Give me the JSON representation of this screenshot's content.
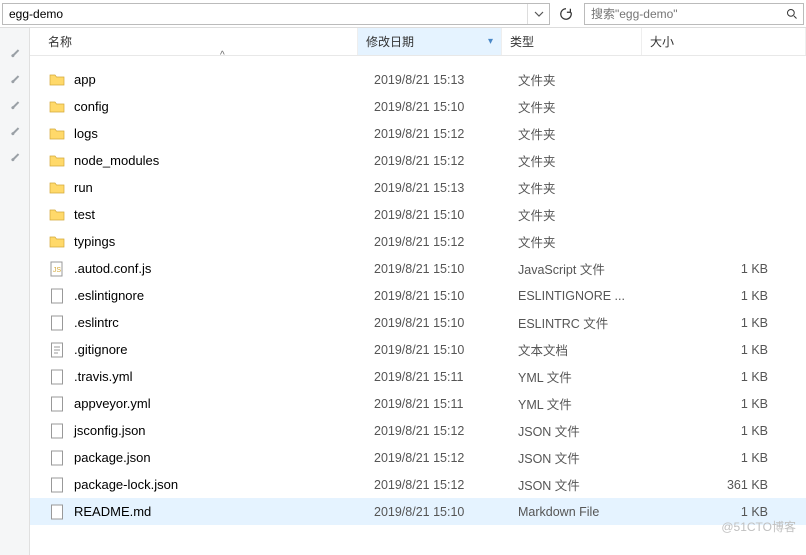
{
  "path": {
    "current": "egg-demo"
  },
  "search": {
    "placeholder": "搜索\"egg-demo\""
  },
  "columns": {
    "name": "名称",
    "date": "修改日期",
    "type": "类型",
    "size": "大小"
  },
  "items": [
    {
      "name": "app",
      "date": "2019/8/21 15:13",
      "type": "文件夹",
      "size": "",
      "kind": "folder"
    },
    {
      "name": "config",
      "date": "2019/8/21 15:10",
      "type": "文件夹",
      "size": "",
      "kind": "folder"
    },
    {
      "name": "logs",
      "date": "2019/8/21 15:12",
      "type": "文件夹",
      "size": "",
      "kind": "folder"
    },
    {
      "name": "node_modules",
      "date": "2019/8/21 15:12",
      "type": "文件夹",
      "size": "",
      "kind": "folder"
    },
    {
      "name": "run",
      "date": "2019/8/21 15:13",
      "type": "文件夹",
      "size": "",
      "kind": "folder"
    },
    {
      "name": "test",
      "date": "2019/8/21 15:10",
      "type": "文件夹",
      "size": "",
      "kind": "folder"
    },
    {
      "name": "typings",
      "date": "2019/8/21 15:12",
      "type": "文件夹",
      "size": "",
      "kind": "folder"
    },
    {
      "name": ".autod.conf.js",
      "date": "2019/8/21 15:10",
      "type": "JavaScript 文件",
      "size": "1 KB",
      "kind": "js"
    },
    {
      "name": ".eslintignore",
      "date": "2019/8/21 15:10",
      "type": "ESLINTIGNORE ...",
      "size": "1 KB",
      "kind": "file"
    },
    {
      "name": ".eslintrc",
      "date": "2019/8/21 15:10",
      "type": "ESLINTRC 文件",
      "size": "1 KB",
      "kind": "file"
    },
    {
      "name": ".gitignore",
      "date": "2019/8/21 15:10",
      "type": "文本文档",
      "size": "1 KB",
      "kind": "text"
    },
    {
      "name": ".travis.yml",
      "date": "2019/8/21 15:11",
      "type": "YML 文件",
      "size": "1 KB",
      "kind": "file"
    },
    {
      "name": "appveyor.yml",
      "date": "2019/8/21 15:11",
      "type": "YML 文件",
      "size": "1 KB",
      "kind": "file"
    },
    {
      "name": "jsconfig.json",
      "date": "2019/8/21 15:12",
      "type": "JSON 文件",
      "size": "1 KB",
      "kind": "file"
    },
    {
      "name": "package.json",
      "date": "2019/8/21 15:12",
      "type": "JSON 文件",
      "size": "1 KB",
      "kind": "file"
    },
    {
      "name": "package-lock.json",
      "date": "2019/8/21 15:12",
      "type": "JSON 文件",
      "size": "361 KB",
      "kind": "file"
    },
    {
      "name": "README.md",
      "date": "2019/8/21 15:10",
      "type": "Markdown File",
      "size": "1 KB",
      "kind": "file",
      "selected": true
    }
  ],
  "watermark": "@51CTO博客"
}
